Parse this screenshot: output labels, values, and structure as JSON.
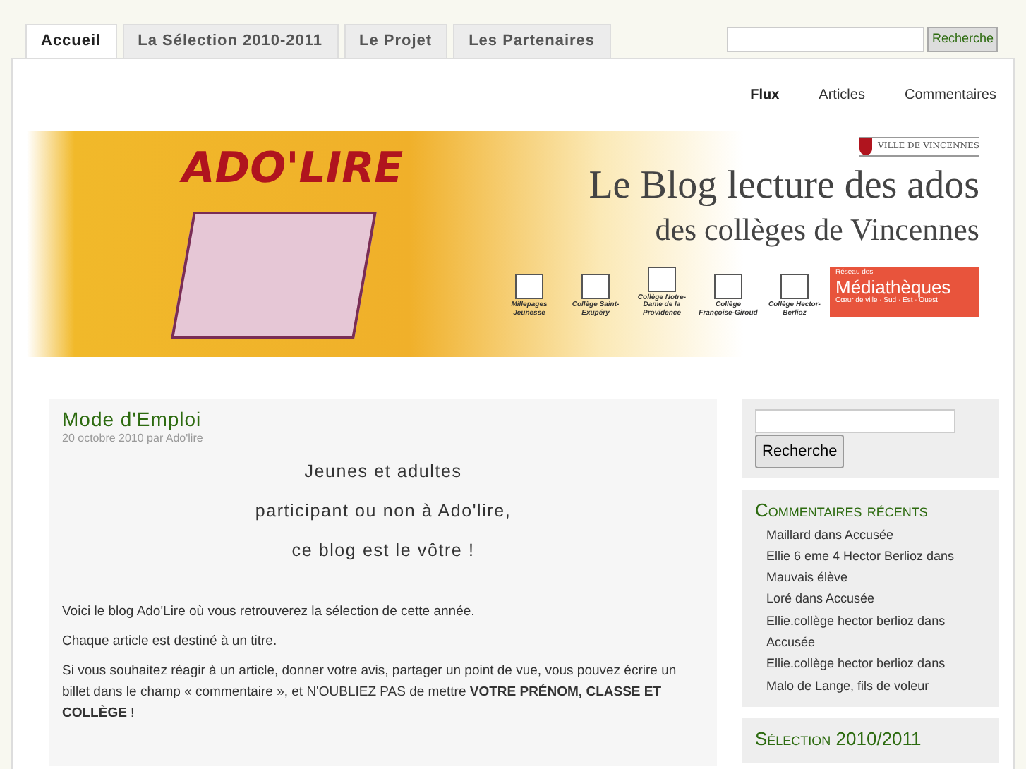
{
  "tabs": [
    {
      "label": "Accueil",
      "selected": true
    },
    {
      "label": "La Sélection 2010-2011",
      "selected": false
    },
    {
      "label": "Le Projet",
      "selected": false
    },
    {
      "label": "Les Partenaires",
      "selected": false
    }
  ],
  "top_search": {
    "button": "Recherche"
  },
  "feeds": [
    {
      "label": "Flux",
      "kind": "plain"
    },
    {
      "label": "Articles",
      "kind": "link"
    },
    {
      "label": "Commentaires",
      "kind": "link"
    }
  ],
  "banner": {
    "logo": "ADO'LIRE",
    "city": "VILLE DE VINCENNES",
    "title": "Le Blog lecture des ados",
    "subtitle": "des collèges de Vincennes",
    "partners": [
      "Millepages Jeunesse",
      "Collège Saint-Exupéry",
      "Collège Notre-Dame de la Providence",
      "Collège Françoise-Giroud",
      "Collège Hector-Berlioz"
    ],
    "network": {
      "small": "Réseau des",
      "name": "Médiathèques",
      "sub": "Cœur de ville · Sud · Est · Ouest"
    }
  },
  "post": {
    "title": "Mode d'Emploi",
    "date": "20 octobre 2010 par",
    "author": "Ado'lire",
    "intro": [
      "Jeunes et adultes",
      "participant ou non à Ado'lire,",
      "ce blog est le vôtre !"
    ],
    "paragraphs": [
      "Voici le blog Ado'Lire où vous retrouverez la sélection de cette année.",
      "Chaque article est destiné à un titre.",
      "Si vous souhaitez réagir à un article, donner votre avis, partager un point de vue, vous pouvez écrire un billet dans le champ « commentaire », et N'OUBLIEZ PAS de mettre **VOTRE PRÉNOM, CLASSE ET COLLÈGE** !"
    ]
  },
  "sidebar": {
    "search_button": "Recherche",
    "recent_title": "Commentaires récents",
    "comments": [
      {
        "author": "Maillard",
        "joiner": "dans",
        "post": "Accusée"
      },
      {
        "author": "Ellie 6 eme 4 Hector Berlioz",
        "joiner": "dans",
        "post": "Mauvais élève"
      },
      {
        "author": "Loré",
        "joiner": "dans",
        "post": "Accusée"
      },
      {
        "author": "Ellie.collège hector berlioz",
        "joiner": "dans",
        "post": "Accusée"
      },
      {
        "author": "Ellie.collège hector berlioz",
        "joiner": "dans",
        "post": "Malo de Lange, fils de voleur"
      }
    ],
    "selection_title": "Sélection 2010/2011"
  }
}
